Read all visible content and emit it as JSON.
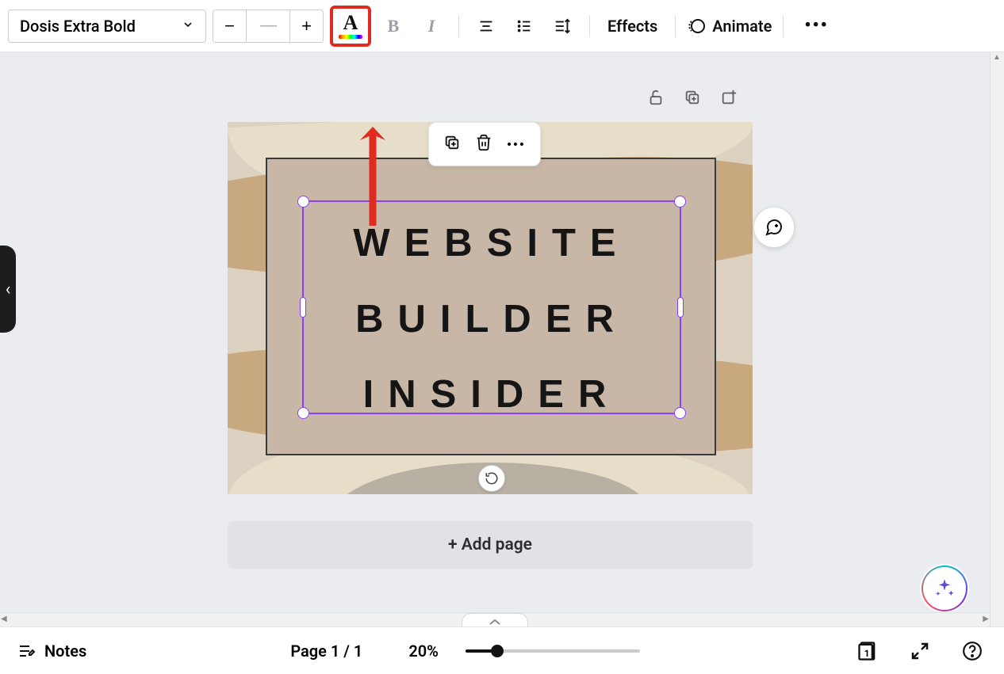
{
  "toolbar": {
    "font_name": "Dosis Extra Bold",
    "size_placeholder": "––",
    "effects_label": "Effects",
    "animate_label": "Animate"
  },
  "canvas": {
    "text_line1": "WEBSITE",
    "text_line2": "BUILDER",
    "text_line3": "INSIDER",
    "add_page_label": "+ Add page"
  },
  "bottombar": {
    "notes_label": "Notes",
    "page_indicator": "Page 1 / 1",
    "zoom_label": "20%",
    "grid_count": "1"
  },
  "colors": {
    "highlight": "#e02b20",
    "selection": "#8b3dff"
  }
}
